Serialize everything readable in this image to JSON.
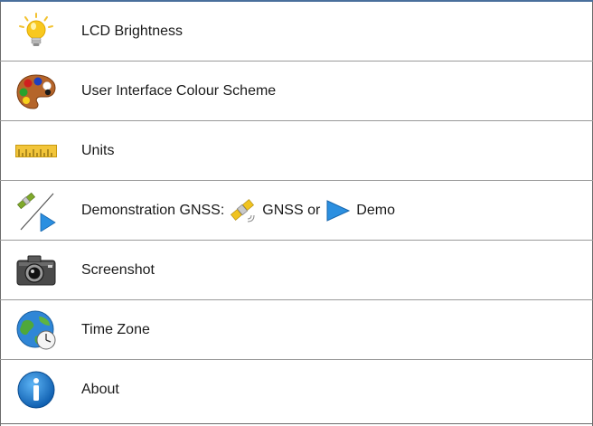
{
  "menu": {
    "items": [
      {
        "label": "LCD Brightness",
        "icon": "lightbulb-icon"
      },
      {
        "label": "User Interface Colour Scheme",
        "icon": "palette-icon"
      },
      {
        "label": "Units",
        "icon": "ruler-icon"
      },
      {
        "label": "Demonstration GNSS:",
        "icon": "satellite-demo-icon",
        "gnss_label": "GNSS or",
        "demo_label": "Demo",
        "gnss_icon": "satellite-icon",
        "demo_icon": "play-arrow-icon"
      },
      {
        "label": "Screenshot",
        "icon": "camera-icon"
      },
      {
        "label": "Time Zone",
        "icon": "globe-clock-icon"
      },
      {
        "label": "About",
        "icon": "info-icon"
      }
    ]
  },
  "colors": {
    "frame_top": "#4a6f9c",
    "divider": "#9a9a9a",
    "accent_blue": "#2b8fe0",
    "bulb_yellow": "#f6c21c",
    "ruler_yellow": "#f1c232"
  }
}
